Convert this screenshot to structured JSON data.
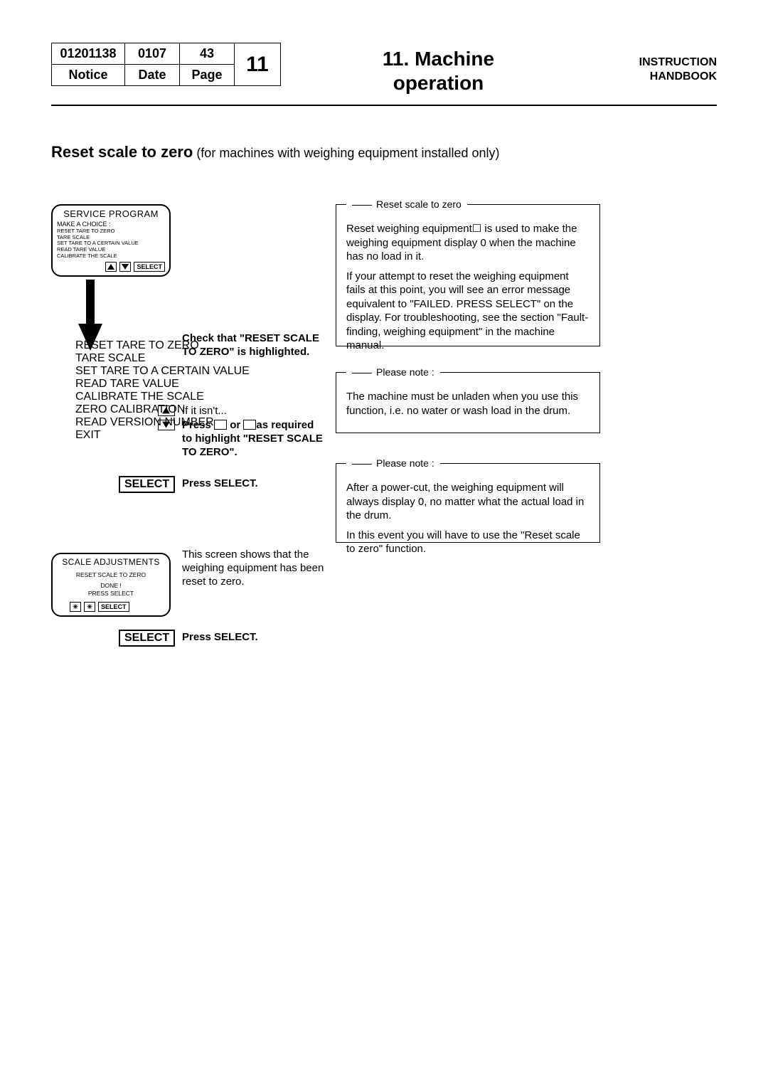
{
  "header": {
    "table": {
      "r1c1": "01201138",
      "r1c2": "0107",
      "r1c3": "43",
      "big": "11",
      "r2c1": "Notice",
      "r2c2": "Date",
      "r2c3": "Page"
    },
    "chapter_line1": "11. Machine",
    "chapter_line2": "operation",
    "handbook_line1": "INSTRUCTION",
    "handbook_line2": "HANDBOOK"
  },
  "section": {
    "title_strong": "Reset scale to zero",
    "title_light": " (for machines with weighing equipment installed only)"
  },
  "device1": {
    "title": "SERVICE PROGRAM",
    "prompt": "MAKE A CHOICE :",
    "items": [
      "RESET TARE TO ZERO",
      "TARE SCALE",
      "SET TARE TO A CERTAIN VALUE",
      "READ TARE VALUE",
      "CALIBRATE THE SCALE"
    ],
    "select": "SELECT"
  },
  "device2": {
    "items": [
      "RESET TARE TO ZERO",
      "TARE SCALE",
      "SET TARE TO A CERTAIN VALUE",
      "READ TARE VALUE",
      "CALIBRATE THE SCALE",
      "ZERO CALIBRATION",
      "READ VERSION NUMBER",
      "EXIT"
    ]
  },
  "instr": {
    "check_line": "Check that \"RESET SCALE TO ZERO\" is highlighted.",
    "ifnot": "If it isn't...",
    "press_prefix": "Press ",
    "press_mid": " or ",
    "press_suffix": "as required to highlight \"RESET SCALE TO ZERO\".",
    "press_select": "Press SELECT.",
    "select_label": "SELECT",
    "screen_shows": "This screen shows that the weighing equipment has been reset to zero.",
    "press_select2": "Press SELECT."
  },
  "device3": {
    "title": "SCALE ADJUSTMENTS",
    "line1": "RESET SCALE TO ZERO",
    "line2": "DONE !",
    "line3": "PRESS SELECT",
    "star": "✳",
    "select": "SELECT"
  },
  "notes": {
    "box1": {
      "legend": "Reset scale to zero",
      "p1": "Reset weighing equipment☐ is used to make the weighing equipment display 0 when the machine has no load in it.",
      "p2": "If your attempt to reset the weighing equipment fails at this point, you will see an error message equivalent to \"FAILED. PRESS SELECT\" on the display. For troubleshooting, see the section \"Fault-finding, weighing equipment\" in the machine manual."
    },
    "box2": {
      "legend": "Please note :",
      "p1": "The machine must be unladen when you use this function, i.e. no water or wash load in the drum."
    },
    "box3": {
      "legend": "Please note :",
      "p1": "After a power-cut, the weighing equipment will always display 0, no matter what the actual load in the drum.",
      "p2": "In this event you will have to use the \"Reset scale to zero\" function."
    }
  }
}
